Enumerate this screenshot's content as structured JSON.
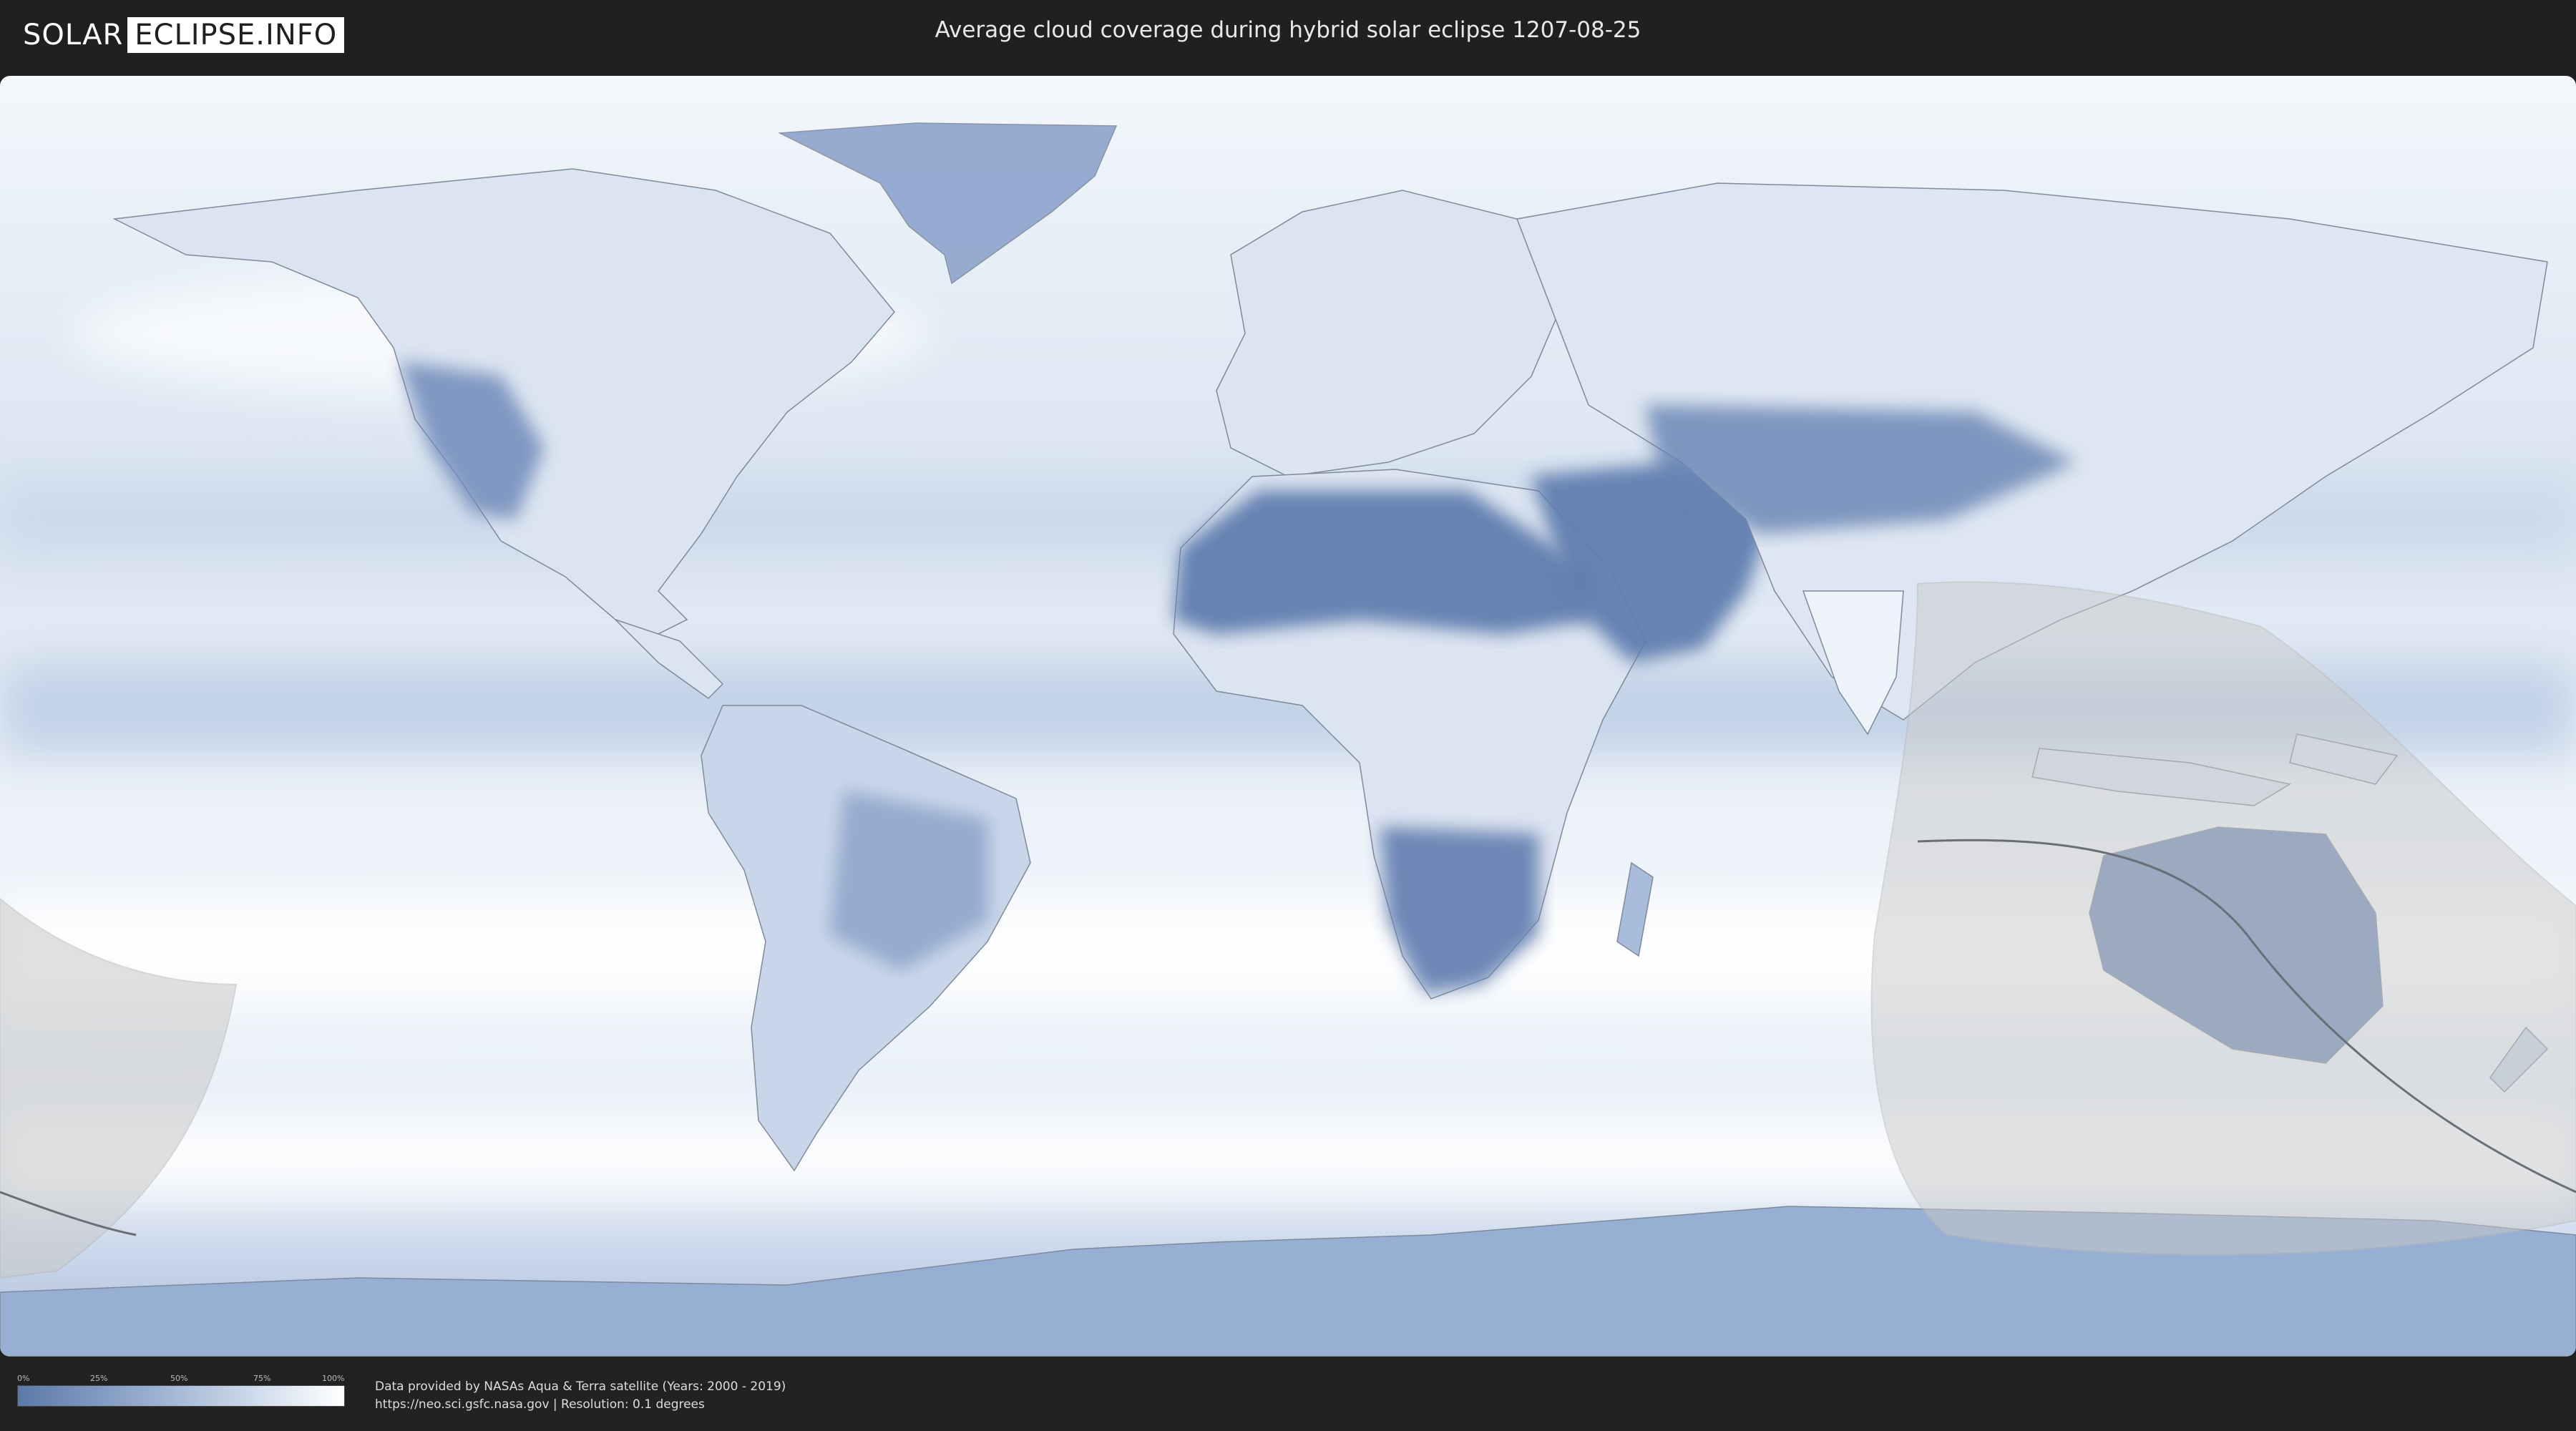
{
  "header": {
    "logo_left": "SOLAR",
    "logo_right": "ECLIPSE.INFO",
    "title": "Average cloud coverage during hybrid solar eclipse 1207-08-25"
  },
  "map": {
    "ocean_color": "#e4ecf5",
    "cloud_color": "#ffffff",
    "land_clear_color": "#5f7eb0",
    "land_mixed_color": "#a9bcdc",
    "shadow_color": "#c9c9c9",
    "path_line_color": "#6a6f77"
  },
  "legend": {
    "ticks": [
      "0%",
      "25%",
      "50%",
      "75%",
      "100%"
    ],
    "gradient": [
      "#5c78a8",
      "#98aecf",
      "#d3deed",
      "#ffffff"
    ]
  },
  "source": {
    "line1": "Data provided by NASAs Aqua & Terra satellite (Years: 2000 - 2019)",
    "line2": "https://neo.sci.gsfc.nasa.gov | Resolution: 0.1 degrees"
  }
}
